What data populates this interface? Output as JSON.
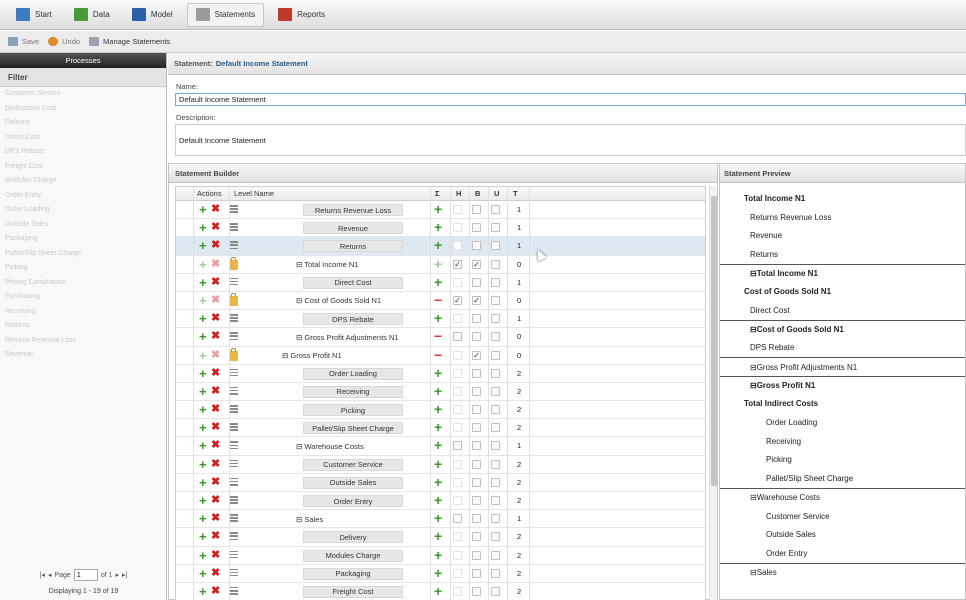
{
  "nav": {
    "tabs": [
      {
        "label": "Start",
        "icon": "start-icon",
        "color": "#3b7bbf"
      },
      {
        "label": "Data",
        "icon": "data-icon",
        "color": "#4a9a3a"
      },
      {
        "label": "Model",
        "icon": "model-icon",
        "color": "#2d5fa8"
      },
      {
        "label": "Statements",
        "icon": "statements-icon",
        "color": "#9a9a9a",
        "active": true
      },
      {
        "label": "Reports",
        "icon": "reports-icon",
        "color": "#c0392b"
      }
    ]
  },
  "toolbar": {
    "save_label": "Save",
    "undo_label": "Undo",
    "manage_label": "Manage Statements"
  },
  "left_panel": {
    "header": "Processes",
    "filter_label": "Filter",
    "items": [
      "Customer Service",
      "Deductions Cost",
      "Delivery",
      "Direct Cost",
      "DPS Rebate",
      "Freight Cost",
      "Modules Charge",
      "Order Entry",
      "Order Loading",
      "Outside Sales",
      "Packaging",
      "Pallet/Slip Sheet Charge",
      "Picking",
      "Pricing Compliance",
      "Purchasing",
      "Receiving",
      "Returns",
      "Returns Revenue Loss",
      "Revenue"
    ],
    "pager": {
      "prefix": "Page",
      "page": "1",
      "of": "of 1",
      "displaying": "Displaying 1 - 19 of 19"
    }
  },
  "statement": {
    "header_label": "Statement:",
    "header_value": "Default Income Statement",
    "name_label": "Name:",
    "name_value": "Default Income Statement",
    "description_label": "Description:",
    "description_value": "Default Income Statement"
  },
  "builder": {
    "title": "Statement Builder",
    "columns": {
      "actions": "Actions",
      "level_name": "Level Name",
      "sigma": "Σ",
      "h": "H",
      "b": "B",
      "u": "U",
      "t": "T"
    },
    "rows": [
      {
        "name": "Returns Revenue Loss",
        "indent": 2,
        "lock": false,
        "sign": "+",
        "h": false,
        "b": false,
        "u": false,
        "t": "1",
        "enabled": true
      },
      {
        "name": "Revenue",
        "indent": 2,
        "lock": false,
        "sign": "+",
        "h": false,
        "b": false,
        "u": false,
        "t": "1",
        "enabled": true
      },
      {
        "name": "Returns",
        "indent": 2,
        "lock": false,
        "sign": "+",
        "h": false,
        "b": false,
        "u": false,
        "t": "1",
        "enabled": true,
        "selected": true
      },
      {
        "name": "⊟ Total Income N1",
        "indent": 1,
        "lock": true,
        "sign": "+",
        "h": true,
        "b": true,
        "u": false,
        "t": "0",
        "enabled": false
      },
      {
        "name": "Direct Cost",
        "indent": 2,
        "lock": false,
        "sign": "+",
        "h": false,
        "b": false,
        "u": false,
        "t": "1",
        "enabled": true
      },
      {
        "name": "⊟ Cost of Goods Sold N1",
        "indent": 1,
        "lock": true,
        "sign": "−",
        "h": true,
        "b": true,
        "u": false,
        "t": "0",
        "enabled": false
      },
      {
        "name": "DPS Rebate",
        "indent": 2,
        "lock": false,
        "sign": "+",
        "h": false,
        "b": false,
        "u": false,
        "t": "1",
        "enabled": true
      },
      {
        "name": "⊟ Gross Profit Adjustments N1",
        "indent": 1,
        "lock": false,
        "sign": "−",
        "h": false,
        "b": false,
        "u": false,
        "t": "0",
        "enabled": true
      },
      {
        "name": "⊟ Gross Profit N1",
        "indent": 0,
        "lock": true,
        "sign": "−",
        "h": false,
        "b": true,
        "u": false,
        "t": "0",
        "enabled": false
      },
      {
        "name": "Order Loading",
        "indent": 2,
        "lock": false,
        "sign": "+",
        "h": false,
        "b": false,
        "u": false,
        "t": "2",
        "enabled": true
      },
      {
        "name": "Receiving",
        "indent": 2,
        "lock": false,
        "sign": "+",
        "h": false,
        "b": false,
        "u": false,
        "t": "2",
        "enabled": true
      },
      {
        "name": "Picking",
        "indent": 2,
        "lock": false,
        "sign": "+",
        "h": false,
        "b": false,
        "u": false,
        "t": "2",
        "enabled": true
      },
      {
        "name": "Pallet/Slip Sheet Charge",
        "indent": 2,
        "lock": false,
        "sign": "+",
        "h": false,
        "b": false,
        "u": false,
        "t": "2",
        "enabled": true
      },
      {
        "name": "⊟ Warehouse Costs",
        "indent": 1,
        "lock": false,
        "sign": "+",
        "h": false,
        "b": false,
        "u": false,
        "t": "1",
        "enabled": true
      },
      {
        "name": "Customer Service",
        "indent": 2,
        "lock": false,
        "sign": "+",
        "h": false,
        "b": false,
        "u": false,
        "t": "2",
        "enabled": true
      },
      {
        "name": "Outside Sales",
        "indent": 2,
        "lock": false,
        "sign": "+",
        "h": false,
        "b": false,
        "u": false,
        "t": "2",
        "enabled": true
      },
      {
        "name": "Order Entry",
        "indent": 2,
        "lock": false,
        "sign": "+",
        "h": false,
        "b": false,
        "u": false,
        "t": "2",
        "enabled": true
      },
      {
        "name": "⊟ Sales",
        "indent": 1,
        "lock": false,
        "sign": "+",
        "h": false,
        "b": false,
        "u": false,
        "t": "1",
        "enabled": true
      },
      {
        "name": "Delivery",
        "indent": 2,
        "lock": false,
        "sign": "+",
        "h": false,
        "b": false,
        "u": false,
        "t": "2",
        "enabled": true
      },
      {
        "name": "Modules Charge",
        "indent": 2,
        "lock": false,
        "sign": "+",
        "h": false,
        "b": false,
        "u": false,
        "t": "2",
        "enabled": true
      },
      {
        "name": "Packaging",
        "indent": 2,
        "lock": false,
        "sign": "+",
        "h": false,
        "b": false,
        "u": false,
        "t": "2",
        "enabled": true
      },
      {
        "name": "Freight Cost",
        "indent": 2,
        "lock": false,
        "sign": "+",
        "h": false,
        "b": false,
        "u": false,
        "t": "2",
        "enabled": true
      }
    ]
  },
  "preview": {
    "title": "Statement Preview",
    "rows": [
      {
        "text": "Total Income N1",
        "bold": true,
        "indent": 0,
        "rule": false
      },
      {
        "text": "Returns Revenue Loss",
        "bold": false,
        "indent": 1,
        "rule": false
      },
      {
        "text": "Revenue",
        "bold": false,
        "indent": 1,
        "rule": false
      },
      {
        "text": "Returns",
        "bold": false,
        "indent": 1,
        "rule": false
      },
      {
        "text": "⊟Total Income N1",
        "bold": true,
        "indent": 1,
        "rule": true
      },
      {
        "text": "Cost of Goods Sold N1",
        "bold": true,
        "indent": 0,
        "rule": false
      },
      {
        "text": "Direct Cost",
        "bold": false,
        "indent": 1,
        "rule": false
      },
      {
        "text": "⊟Cost of Goods Sold N1",
        "bold": true,
        "indent": 1,
        "rule": true
      },
      {
        "text": "DPS Rebate",
        "bold": false,
        "indent": 1,
        "rule": false
      },
      {
        "text": "⊟Gross Profit Adjustments N1",
        "bold": false,
        "indent": 1,
        "rule": true
      },
      {
        "text": "⊟Gross Profit N1",
        "bold": true,
        "indent": 1,
        "rule": true
      },
      {
        "text": "Total Indirect Costs",
        "bold": true,
        "indent": 0,
        "rule": false
      },
      {
        "text": "Order Loading",
        "bold": false,
        "indent": 2,
        "rule": false
      },
      {
        "text": "Receiving",
        "bold": false,
        "indent": 2,
        "rule": false
      },
      {
        "text": "Picking",
        "bold": false,
        "indent": 2,
        "rule": false
      },
      {
        "text": "Pallet/Slip Sheet Charge",
        "bold": false,
        "indent": 2,
        "rule": false
      },
      {
        "text": "⊟Warehouse Costs",
        "bold": false,
        "indent": 1,
        "rule": true
      },
      {
        "text": "Customer Service",
        "bold": false,
        "indent": 2,
        "rule": false
      },
      {
        "text": "Outside Sales",
        "bold": false,
        "indent": 2,
        "rule": false
      },
      {
        "text": "Order Entry",
        "bold": false,
        "indent": 2,
        "rule": false
      },
      {
        "text": "⊟Sales",
        "bold": false,
        "indent": 1,
        "rule": true
      }
    ]
  }
}
